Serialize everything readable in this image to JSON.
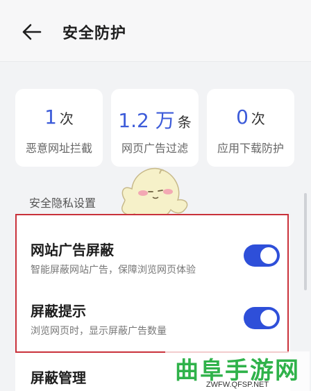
{
  "header": {
    "back_icon": "arrow-left-icon",
    "title": "安全防护"
  },
  "stats": [
    {
      "value": "1",
      "unit": "次",
      "label": "恶意网址拦截"
    },
    {
      "value": "1.2 万",
      "unit": "条",
      "label": "网页广告过滤"
    },
    {
      "value": "0",
      "unit": "次",
      "label": "应用下载防护"
    }
  ],
  "section": {
    "label": "安全隐私设置"
  },
  "settings": [
    {
      "title": "网站广告屏蔽",
      "description": "智能屏蔽网站广告，保障浏览网页体验",
      "enabled": true
    },
    {
      "title": "屏蔽提示",
      "description": "浏览网页时，显示屏蔽广告数量",
      "enabled": true
    },
    {
      "title": "屏蔽管理"
    }
  ],
  "colors": {
    "accent": "#2e4fd9",
    "stat_number": "#3c5bd9",
    "highlight_border": "#c9313a",
    "watermark": "#2fb24a"
  },
  "watermark": {
    "text": "曲阜手游网",
    "url": "ZWFW.QFSP.NET"
  }
}
